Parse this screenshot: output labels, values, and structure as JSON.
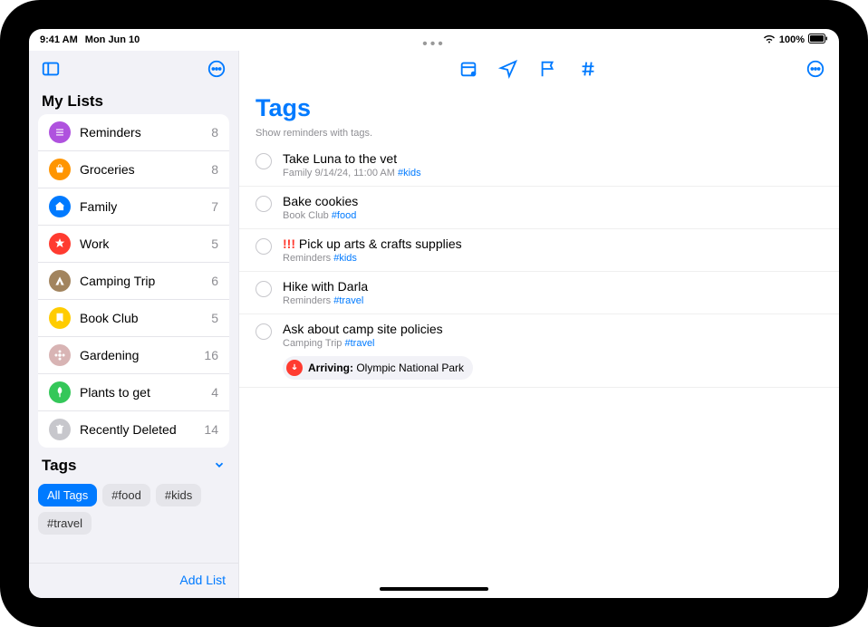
{
  "status": {
    "time": "9:41 AM",
    "date": "Mon Jun 10",
    "battery": "100%"
  },
  "sidebar": {
    "section_title": "My Lists",
    "lists": [
      {
        "label": "Reminders",
        "count": "8",
        "color": "#af52de"
      },
      {
        "label": "Groceries",
        "count": "8",
        "color": "#ff9500"
      },
      {
        "label": "Family",
        "count": "7",
        "color": "#007aff"
      },
      {
        "label": "Work",
        "count": "5",
        "color": "#ff3b30"
      },
      {
        "label": "Camping Trip",
        "count": "6",
        "color": "#a2845e"
      },
      {
        "label": "Book Club",
        "count": "5",
        "color": "#ffcc00"
      },
      {
        "label": "Gardening",
        "count": "16",
        "color": "#d8b4b4"
      },
      {
        "label": "Plants to get",
        "count": "4",
        "color": "#34c759"
      },
      {
        "label": "Recently Deleted",
        "count": "14",
        "color": "#c7c7cc"
      }
    ],
    "tags_title": "Tags",
    "tags": [
      {
        "label": "All Tags",
        "selected": true
      },
      {
        "label": "#food",
        "selected": false
      },
      {
        "label": "#kids",
        "selected": false
      },
      {
        "label": "#travel",
        "selected": false
      }
    ],
    "add_list": "Add List"
  },
  "content": {
    "title": "Tags",
    "subtitle": "Show reminders with tags.",
    "reminders": [
      {
        "title": "Take Luna to the vet",
        "meta_prefix": "Family  9/14/24, 11:00 AM  ",
        "tag": "#kids",
        "priority": ""
      },
      {
        "title": "Bake cookies",
        "meta_prefix": "Book Club  ",
        "tag": "#food",
        "priority": ""
      },
      {
        "title": "Pick up arts & crafts supplies",
        "meta_prefix": "Reminders  ",
        "tag": "#kids",
        "priority": "!!! "
      },
      {
        "title": "Hike with Darla",
        "meta_prefix": "Reminders  ",
        "tag": "#travel",
        "priority": ""
      },
      {
        "title": "Ask about camp site policies",
        "meta_prefix": "Camping Trip  ",
        "tag": "#travel",
        "priority": ""
      }
    ],
    "location": {
      "label": "Arriving:",
      "place": " Olympic National Park"
    }
  }
}
